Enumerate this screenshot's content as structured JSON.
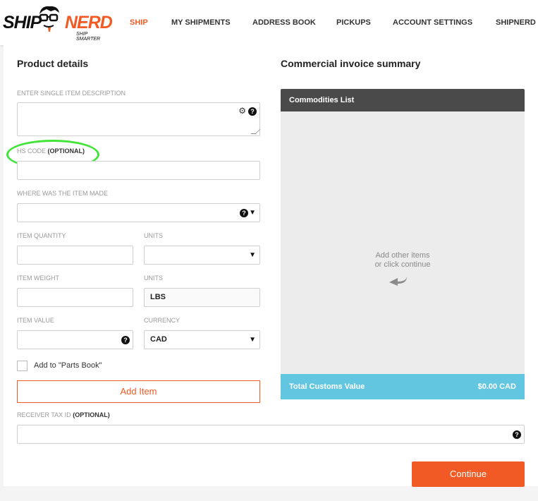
{
  "header": {
    "logo": {
      "primary": "SHIP",
      "secondary": "NERD",
      "tagline": "SHIP SMARTER"
    },
    "nav": [
      {
        "label": "SHIP",
        "active": true
      },
      {
        "label": "MY SHIPMENTS",
        "active": false
      },
      {
        "label": "ADDRESS BOOK",
        "active": false
      },
      {
        "label": "PICKUPS",
        "active": false
      },
      {
        "label": "ACCOUNT SETTINGS",
        "active": false
      },
      {
        "label": "SHIPNERD",
        "active": false
      }
    ]
  },
  "product_details": {
    "title": "Product details",
    "description_label": "ENTER SINGLE ITEM DESCRIPTION",
    "description_value": "",
    "hs_code_label": "HS CODE",
    "hs_code_optional": "(OPTIONAL)",
    "hs_code_value": "",
    "origin_label": "WHERE WAS THE ITEM MADE",
    "origin_value": "",
    "quantity_label": "ITEM QUANTITY",
    "quantity_value": "",
    "quantity_units_label": "UNITS",
    "quantity_units_value": "",
    "weight_label": "ITEM WEIGHT",
    "weight_value": "",
    "weight_units_label": "UNITS",
    "weight_units_value": "LBS",
    "value_label": "ITEM VALUE",
    "value_value": "",
    "currency_label": "CURRENCY",
    "currency_value": "CAD",
    "parts_book_label": "Add to \"Parts Book\"",
    "parts_book_checked": false,
    "add_item_label": "Add Item",
    "receiver_tax_label": "RECEIVER TAX ID",
    "receiver_tax_optional": "(OPTIONAL)",
    "receiver_tax_value": ""
  },
  "invoice_summary": {
    "title": "Commercial invoice summary",
    "list_header": "Commodities List",
    "empty_line1": "Add other items",
    "empty_line2": "or click continue",
    "total_label": "Total Customs Value",
    "total_value": "$0.00 CAD"
  },
  "actions": {
    "continue_label": "Continue"
  },
  "icons": {
    "help": "question-circle-icon",
    "gear": "gears-icon",
    "caret": "caret-down-icon",
    "return": "return-arrow-icon"
  },
  "colors": {
    "accent": "#f15a24",
    "summary_header": "#4a4a4a",
    "summary_footer": "#63c6e1",
    "annotation": "#43e43a"
  }
}
